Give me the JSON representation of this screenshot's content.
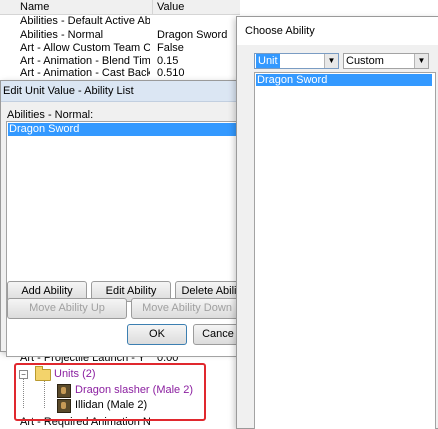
{
  "grid": {
    "col_name": "Name",
    "col_value": "Value",
    "rows": [
      {
        "name": "Abilities - Default Active Ability",
        "value": ""
      },
      {
        "name": "Abilities - Normal",
        "value": "Dragon Sword"
      },
      {
        "name": "Art - Allow Custom Team Color",
        "value": "False"
      },
      {
        "name": "Art - Animation - Blend Time ...",
        "value": "0.15"
      },
      {
        "name": "Art - Animation - Cast Backs...",
        "value": "0.510"
      }
    ],
    "lower_rows": [
      {
        "name": "Art - Projectile Launch - Y",
        "value": "0.00"
      },
      {
        "name": "Art - Required Animation Na...",
        "value": ""
      }
    ]
  },
  "tree": {
    "expander_minus": "−",
    "folder_label": "Units (2)",
    "units": [
      {
        "label": "Dragon slasher (Male 2)",
        "color": "#8b1fa0",
        "icon": "unit-portrait-icon"
      },
      {
        "label": "Illidan (Male 2)",
        "color": "#000000",
        "icon": "unit-portrait-icon"
      }
    ],
    "highlight_color": "#e0282e"
  },
  "edit_dialog": {
    "title": "Edit Unit Value - Ability List",
    "list_label": "Abilities - Normal:",
    "items": [
      "Dragon Sword"
    ],
    "buttons": {
      "add": "Add Ability",
      "edit": "Edit Ability",
      "delete": "Delete Abili",
      "move_up": "Move Ability Up",
      "move_down": "Move Ability Down",
      "ok": "OK",
      "cancel": "Cance"
    }
  },
  "choose_dialog": {
    "title": "Choose Ability",
    "filter_type": {
      "value": "Unit",
      "options_visible": [
        "Unit"
      ]
    },
    "filter_source": {
      "value": "Custom",
      "options_visible": [
        "Custom"
      ]
    },
    "items": [
      "Dragon Sword"
    ]
  },
  "colors": {
    "selection": "#3399ff",
    "dialog_bg": "#f0f0f0",
    "title_bar": "#dbe6f3"
  }
}
